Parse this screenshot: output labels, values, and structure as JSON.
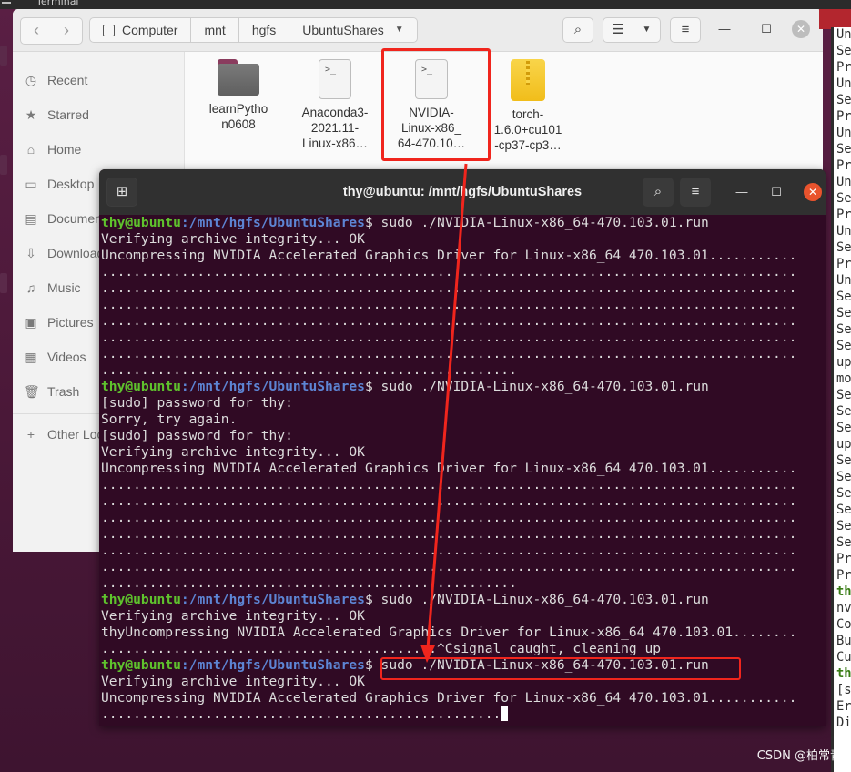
{
  "top_strip": {
    "title": "Terminal"
  },
  "file_manager": {
    "path": [
      "Computer",
      "mnt",
      "hgfs",
      "UbuntuShares"
    ],
    "sidebar": [
      {
        "icon": "clock-icon",
        "glyph": "◷",
        "label": "Recent"
      },
      {
        "icon": "star-icon",
        "glyph": "★",
        "label": "Starred"
      },
      {
        "icon": "home-icon",
        "glyph": "⌂",
        "label": "Home"
      },
      {
        "icon": "desktop-icon",
        "glyph": "▭",
        "label": "Desktop"
      },
      {
        "icon": "document-icon",
        "glyph": "▤",
        "label": "Documents"
      },
      {
        "icon": "download-icon",
        "glyph": "⇩",
        "label": "Downloads"
      },
      {
        "icon": "music-icon",
        "glyph": "♫",
        "label": "Music"
      },
      {
        "icon": "picture-icon",
        "glyph": "▣",
        "label": "Pictures"
      },
      {
        "icon": "video-icon",
        "glyph": "▦",
        "label": "Videos"
      },
      {
        "icon": "trash-icon",
        "glyph": "🗑",
        "label": "Trash"
      },
      {
        "icon": "plus-icon",
        "glyph": "+",
        "label": "Other Locations"
      }
    ],
    "files": [
      {
        "name_lines": [
          "learnPytho",
          "n0608"
        ],
        "kind": "folder"
      },
      {
        "name_lines": [
          "Anaconda3-",
          "2021.11-",
          "Linux-x86…"
        ],
        "kind": "script"
      },
      {
        "name_lines": [
          "NVIDIA-",
          "Linux-x86_",
          "64-470.10…"
        ],
        "kind": "script"
      },
      {
        "name_lines": [
          "torch-",
          "1.6.0+cu101",
          "-cp37-cp3…"
        ],
        "kind": "archive"
      }
    ]
  },
  "terminal": {
    "title": "thy@ubuntu: /mnt/hgfs/UbuntuShares",
    "prompt_user": "thy@ubuntu",
    "prompt_path": ":/mnt/hgfs/UbuntuShares",
    "lines": [
      {
        "type": "prompt",
        "cmd": "$ sudo ./NVIDIA-Linux-x86_64-470.103.01.run"
      },
      {
        "type": "text",
        "text": "Verifying archive integrity... OK"
      },
      {
        "type": "text",
        "text": "Uncompressing NVIDIA Accelerated Graphics Driver for Linux-x86_64 470.103.01..........."
      },
      {
        "type": "text",
        "text": "......................................................................................."
      },
      {
        "type": "text",
        "text": "......................................................................................."
      },
      {
        "type": "text",
        "text": "......................................................................................."
      },
      {
        "type": "text",
        "text": "......................................................................................."
      },
      {
        "type": "text",
        "text": "......................................................................................."
      },
      {
        "type": "text",
        "text": "......................................................................................."
      },
      {
        "type": "text",
        "text": "...................................................."
      },
      {
        "type": "prompt",
        "cmd": "$ sudo ./NVIDIA-Linux-x86_64-470.103.01.run"
      },
      {
        "type": "text",
        "text": "[sudo] password for thy:"
      },
      {
        "type": "text",
        "text": "Sorry, try again."
      },
      {
        "type": "text",
        "text": "[sudo] password for thy:"
      },
      {
        "type": "text",
        "text": "Verifying archive integrity... OK"
      },
      {
        "type": "text",
        "text": "Uncompressing NVIDIA Accelerated Graphics Driver for Linux-x86_64 470.103.01..........."
      },
      {
        "type": "text",
        "text": "......................................................................................."
      },
      {
        "type": "text",
        "text": "......................................................................................."
      },
      {
        "type": "text",
        "text": "......................................................................................."
      },
      {
        "type": "text",
        "text": "......................................................................................."
      },
      {
        "type": "text",
        "text": "......................................................................................."
      },
      {
        "type": "text",
        "text": "......................................................................................."
      },
      {
        "type": "text",
        "text": "...................................................."
      },
      {
        "type": "prompt",
        "cmd": "$ sudo ./NVIDIA-Linux-x86_64-470.103.01.run"
      },
      {
        "type": "text",
        "text": "Verifying archive integrity... OK"
      },
      {
        "type": "text",
        "text": "thyUncompressing NVIDIA Accelerated Graphics Driver for Linux-x86_64 470.103.01........"
      },
      {
        "type": "text",
        "text": "..........................................^Csignal caught, cleaning up"
      },
      {
        "type": "prompt",
        "cmd": "$ sudo ./NVIDIA-Linux-x86_64-470.103.01.run"
      },
      {
        "type": "text",
        "text": "Verifying archive integrity... OK"
      },
      {
        "type": "text",
        "text": "Uncompressing NVIDIA Accelerated Graphics Driver for Linux-x86_64 470.103.01..........."
      },
      {
        "type": "text",
        "text": "..................................................",
        "cursor": true
      }
    ]
  },
  "right_window": {
    "lines": [
      "Un",
      "Se",
      "Pr",
      "Un",
      "Se",
      "Pr",
      "Un",
      "Se",
      "Pr",
      "Un",
      "Se",
      "Pr",
      "Un",
      "Se",
      "Pr",
      "Un",
      "Se",
      "Se",
      "Se",
      "Se",
      "up",
      "mo",
      "Se",
      "Se",
      "Se",
      "up",
      "Se",
      "Se",
      "Se",
      "Se",
      "Se",
      "Se",
      "Pr",
      "Pr",
      "th",
      "nv",
      "Co",
      "Bu",
      "Cu",
      "th",
      "[s",
      "Er",
      "Di"
    ],
    "bold_indices": [
      34,
      39
    ]
  },
  "watermark": "CSDN @柏常青",
  "colors": {
    "terminal_bg": "#300a24",
    "prompt_user": "#5fc32d",
    "prompt_path": "#5d85d4",
    "highlight": "#f0251d",
    "close_button": "#e9532d"
  }
}
